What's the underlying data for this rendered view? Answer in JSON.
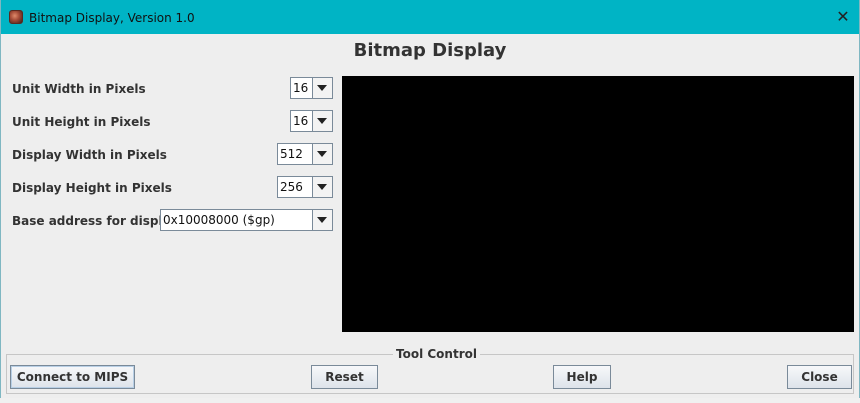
{
  "window": {
    "title": "Bitmap Display, Version 1.0",
    "close_glyph": "✕",
    "app_icon": "mars-icon"
  },
  "heading": "Bitmap Display",
  "settings": {
    "unit_width": {
      "label": "Unit Width in Pixels",
      "value": "16"
    },
    "unit_height": {
      "label": "Unit Height in Pixels",
      "value": "16"
    },
    "display_width": {
      "label": "Display Width in Pixels",
      "value": "512"
    },
    "display_height": {
      "label": "Display Height in Pixels",
      "value": "256"
    },
    "base_address": {
      "label": "Base address for display",
      "value": "0x10008000 ($gp)"
    }
  },
  "display": {
    "background": "#000000"
  },
  "tool_control": {
    "legend": "Tool Control",
    "connect_label": "Connect to MIPS",
    "reset_label": "Reset",
    "help_label": "Help",
    "close_label": "Close"
  },
  "colors": {
    "titlebar": "#00b4c5",
    "window_bg": "#eeeeee"
  }
}
